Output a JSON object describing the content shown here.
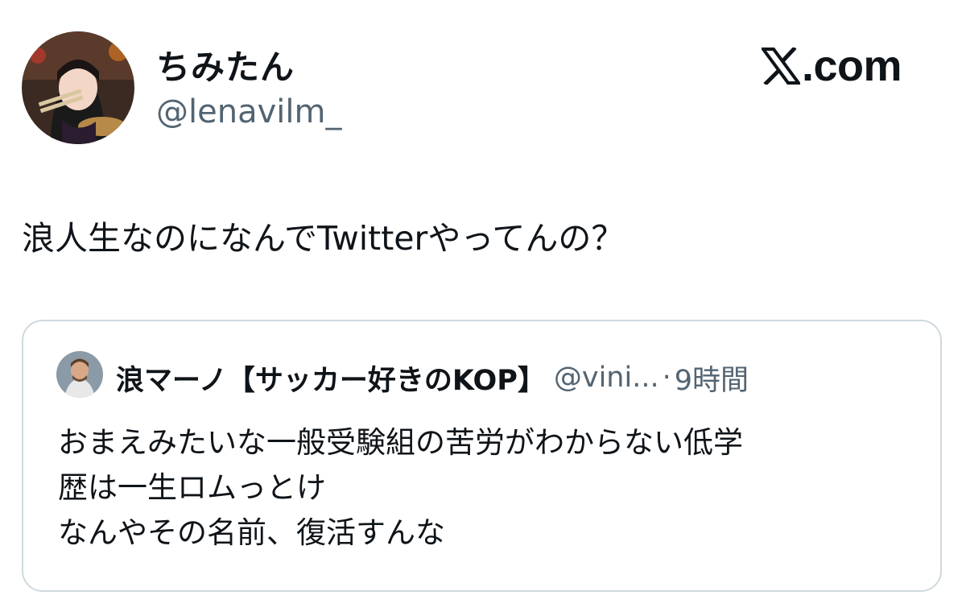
{
  "author": {
    "display_name": "ちみたん",
    "handle": "@lenavilm_",
    "avatar_icon": "user-avatar-photo"
  },
  "brand": {
    "icon": "x-logo-icon",
    "text": ".com"
  },
  "tweet": {
    "text": "浪人生なのになんでTwitterやってんの？"
  },
  "quoted_tweet": {
    "display_name": "浪マーノ【サッカー好きのKOP】",
    "handle": "@vini...",
    "separator": "·",
    "time": "9時間",
    "avatar_icon": "quoted-user-avatar-photo",
    "lines": [
      "おまえみたいな一般受験組の苦労がわからない低学",
      "歴は一生ロムっとけ",
      "なんやその名前、復活すんな"
    ]
  },
  "colors": {
    "text_primary": "#0f1419",
    "text_secondary": "#536471",
    "border": "#cfd9de",
    "background": "#ffffff"
  }
}
